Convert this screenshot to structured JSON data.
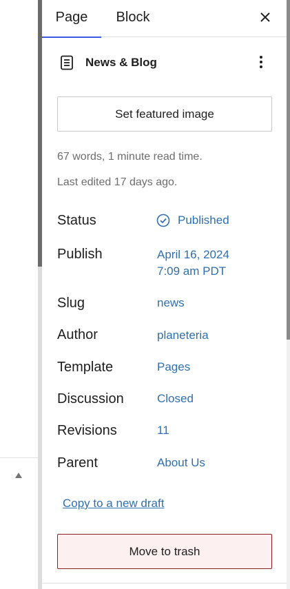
{
  "tabs": [
    {
      "label": "Page",
      "active": true
    },
    {
      "label": "Block",
      "active": false
    }
  ],
  "header": {
    "close_icon": "close-icon",
    "title": "News & Blog",
    "doc_icon": "page-icon",
    "more_icon": "more-vertical-icon"
  },
  "featured_image": {
    "label": "Set featured image"
  },
  "stats": {
    "word_count": "67 words, 1 minute read time.",
    "last_edited": "Last edited 17 days ago."
  },
  "fields": [
    {
      "label": "Status",
      "value": "Published"
    },
    {
      "label": "Publish",
      "value": "April 16, 2024",
      "value2": "7:09 am PDT"
    },
    {
      "label": "Slug",
      "value": "news"
    },
    {
      "label": "Author",
      "value": "planeteria"
    },
    {
      "label": "Template",
      "value": "Pages"
    },
    {
      "label": "Discussion",
      "value": "Closed"
    },
    {
      "label": "Revisions",
      "value": "11"
    },
    {
      "label": "Parent",
      "value": "About Us"
    }
  ],
  "actions": {
    "copy_draft": "Copy to a new draft",
    "trash": "Move to trash"
  },
  "colors": {
    "accent": "#3858e9",
    "link": "#2f6fb0",
    "danger_border": "#8b1d1d",
    "danger_bg": "#fcf0f1"
  }
}
